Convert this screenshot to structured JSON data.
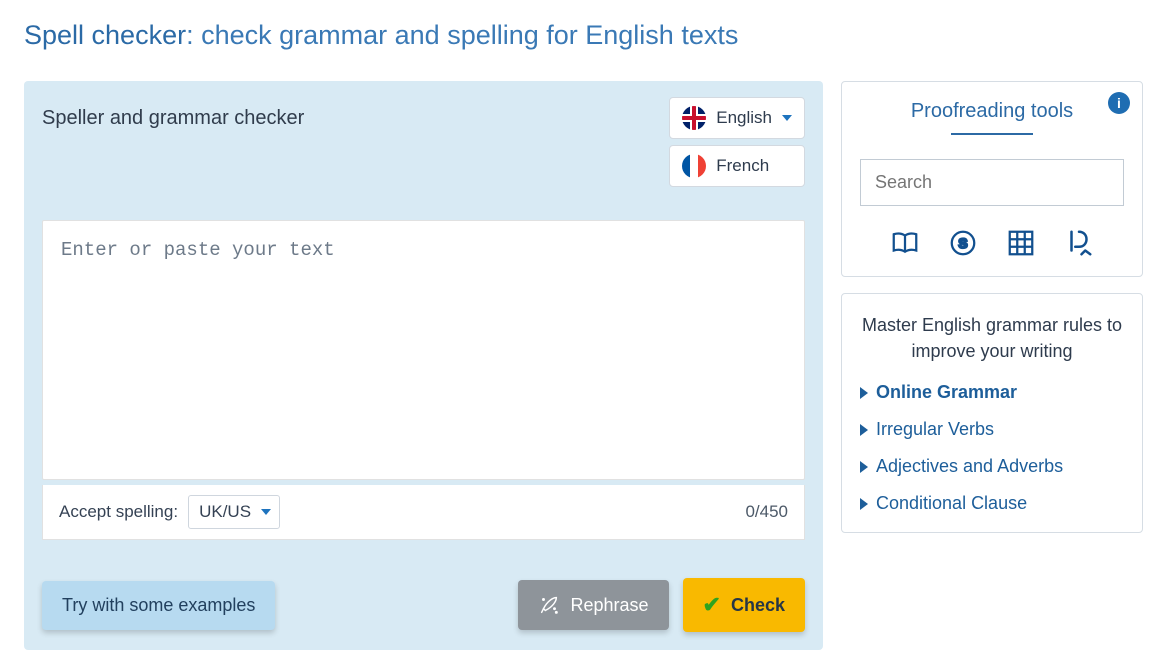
{
  "title": {
    "strong": "Spell checker",
    "rest": ": check grammar and spelling for English texts"
  },
  "panel": {
    "title": "Speller and grammar checker",
    "langs": [
      {
        "label": "English",
        "flag": "uk",
        "has_caret": true
      },
      {
        "label": "French",
        "flag": "fr",
        "has_caret": false
      }
    ],
    "placeholder": "Enter or paste your text",
    "value": "",
    "accept_label": "Accept spelling:",
    "accept_value": "UK/US",
    "counter": "0/450",
    "btn_examples": "Try with some examples",
    "btn_rephrase": "Rephrase",
    "btn_check": "Check"
  },
  "sidebar": {
    "proof_title": "Proofreading tools",
    "search_placeholder": "Search",
    "master_text": "Master English grammar rules to improve your writing",
    "links": [
      {
        "label": "Online Grammar",
        "bold": true
      },
      {
        "label": "Irregular Verbs",
        "bold": false
      },
      {
        "label": "Adjectives and Adverbs",
        "bold": false
      },
      {
        "label": "Conditional Clause",
        "bold": false
      }
    ]
  }
}
